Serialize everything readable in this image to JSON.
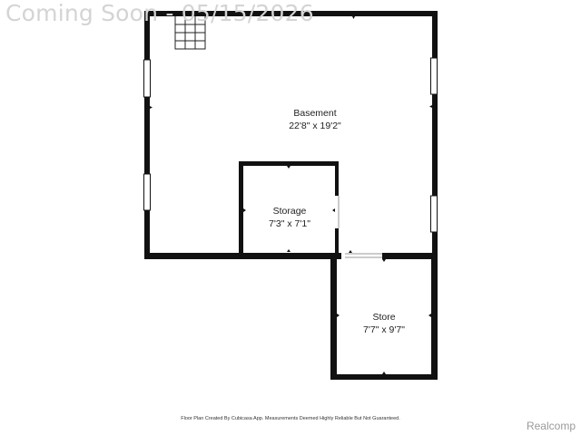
{
  "watermark": {
    "text": "Coming Soon - 05/15/2026"
  },
  "rooms": {
    "basement": {
      "name": "Basement",
      "dims": "22'8\" x 19'2\""
    },
    "storage": {
      "name": "Storage",
      "dims": "7'3\" x 7'1\""
    },
    "store": {
      "name": "Store",
      "dims": "7'7\" x 9'7\""
    }
  },
  "footer": {
    "disclaimer": "Floor Plan Created By Cubicasa App. Measurements Deemed Highly Reliable But Not Guaranteed.",
    "brand": "Realcomp"
  },
  "colors": {
    "wall": "#111111",
    "window": "#ffffff",
    "watermark": "#d4d4d4"
  }
}
